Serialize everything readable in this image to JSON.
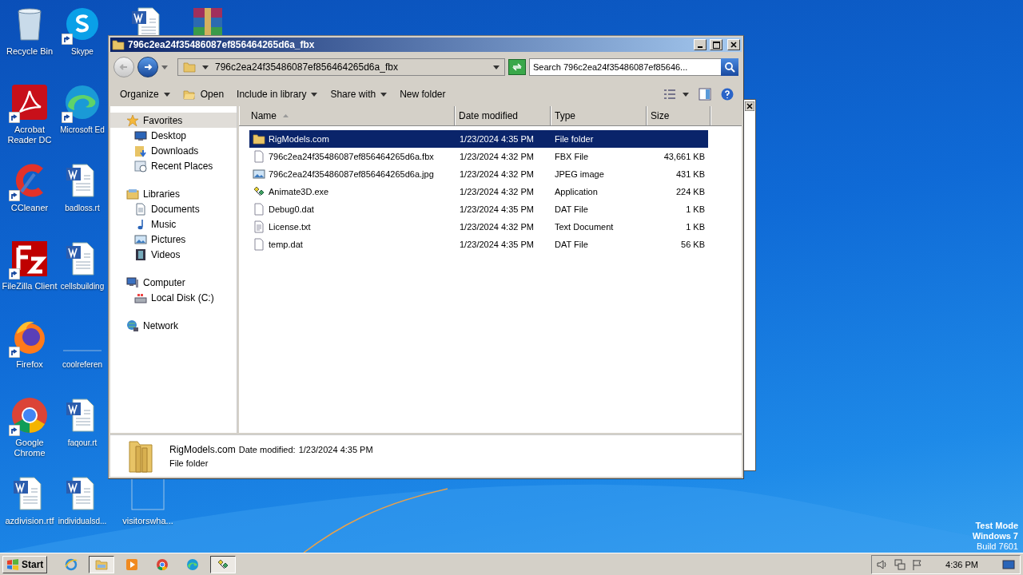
{
  "desktop": {
    "icons": [
      {
        "label": "Recycle Bin",
        "kind": "recycle",
        "shortcut": false
      },
      {
        "label": "Acrobat Reader DC",
        "kind": "acrobat",
        "shortcut": true
      },
      {
        "label": "CCleaner",
        "kind": "ccleaner",
        "shortcut": true
      },
      {
        "label": "FileZilla Client",
        "kind": "filezilla",
        "shortcut": true
      },
      {
        "label": "Firefox",
        "kind": "firefox",
        "shortcut": true
      },
      {
        "label": "Google Chrome",
        "kind": "chrome",
        "shortcut": true
      },
      {
        "label": "azdivision.rtf",
        "kind": "word",
        "shortcut": false
      },
      {
        "label": "Skype",
        "kind": "skype",
        "shortcut": true
      },
      {
        "label": "Microsoft Ed",
        "kind": "edge",
        "shortcut": true
      },
      {
        "label": "badloss.rt",
        "kind": "word",
        "shortcut": false
      },
      {
        "label": "cellsbuilding",
        "kind": "word",
        "shortcut": false
      },
      {
        "label": "coolreferen",
        "kind": "blank",
        "shortcut": false
      },
      {
        "label": "faqour.rt",
        "kind": "word",
        "shortcut": false
      },
      {
        "label": "individualsd...",
        "kind": "word",
        "shortcut": false
      },
      {
        "kind": "word",
        "shortcut": false
      },
      {
        "label": "visitorswha...",
        "kind": "outline",
        "shortcut": false
      },
      {
        "kind": "winrar",
        "shortcut": false
      }
    ]
  },
  "explorer": {
    "title": "796c2ea24f35486087ef856464265d6a_fbx",
    "back_disabled": true,
    "address": "796c2ea24f35486087ef856464265d6a_fbx",
    "search": {
      "placeholder": "Search 796c2ea24f35486087ef85646..."
    },
    "toolbar": [
      {
        "label": "Organize",
        "kind": "menu"
      },
      {
        "label": "Open",
        "kind": "open"
      },
      {
        "label": "Include in library",
        "kind": "menu"
      },
      {
        "label": "Share with",
        "kind": "menu"
      },
      {
        "label": "New folder",
        "kind": "plain"
      }
    ],
    "nav": [
      {
        "label": "Favorites",
        "kind": "star",
        "selected": true,
        "children": [
          {
            "label": "Desktop",
            "kind": "desktop",
            "selected": false
          },
          {
            "label": "Downloads",
            "kind": "downloads",
            "selected": false
          },
          {
            "label": "Recent Places",
            "kind": "recent",
            "selected": false
          }
        ]
      },
      {
        "label": "Libraries",
        "kind": "libraries",
        "selected": false,
        "children": [
          {
            "label": "Documents",
            "kind": "documents",
            "selected": false
          },
          {
            "label": "Music",
            "kind": "music",
            "selected": false
          },
          {
            "label": "Pictures",
            "kind": "pictures",
            "selected": false
          },
          {
            "label": "Videos",
            "kind": "videos",
            "selected": false
          }
        ]
      },
      {
        "label": "Computer",
        "kind": "computer",
        "selected": false,
        "children": [
          {
            "label": "Local Disk (C:)",
            "kind": "disk",
            "selected": false
          }
        ]
      },
      {
        "label": "Network",
        "kind": "network",
        "selected": false
      }
    ],
    "columns": [
      {
        "label": "Name",
        "sorted": true
      },
      {
        "label": "Date modified",
        "sorted": false
      },
      {
        "label": "Type",
        "sorted": false
      },
      {
        "label": "Size",
        "sorted": false
      }
    ],
    "rows": [
      {
        "name": "RigModels.com",
        "kind": "folder",
        "date": "1/23/2024 4:35 PM",
        "type": "File folder",
        "size": "",
        "selected": true
      },
      {
        "name": "796c2ea24f35486087ef856464265d6a.fbx",
        "kind": "file",
        "date": "1/23/2024 4:32 PM",
        "type": "FBX File",
        "size": "43,661 KB",
        "selected": false
      },
      {
        "name": "796c2ea24f35486087ef856464265d6a.jpg",
        "kind": "image",
        "date": "1/23/2024 4:32 PM",
        "type": "JPEG image",
        "size": "431 KB",
        "selected": false
      },
      {
        "name": "Animate3D.exe",
        "kind": "app",
        "date": "1/23/2024 4:32 PM",
        "type": "Application",
        "size": "224 KB",
        "selected": false
      },
      {
        "name": "Debug0.dat",
        "kind": "file",
        "date": "1/23/2024 4:35 PM",
        "type": "DAT File",
        "size": "1 KB",
        "selected": false
      },
      {
        "name": "License.txt",
        "kind": "text",
        "date": "1/23/2024 4:32 PM",
        "type": "Text Document",
        "size": "1 KB",
        "selected": false
      },
      {
        "name": "temp.dat",
        "kind": "file",
        "date": "1/23/2024 4:35 PM",
        "type": "DAT File",
        "size": "56 KB",
        "selected": false
      }
    ],
    "details": {
      "name": "RigModels.com",
      "date_label": "Date modified:",
      "date": "1/23/2024 4:35 PM",
      "type": "File folder"
    }
  },
  "taskbar": {
    "start": "Start",
    "apps": [
      {
        "kind": "ie",
        "selected": false
      },
      {
        "kind": "explorer",
        "selected": true
      },
      {
        "kind": "media",
        "selected": false
      },
      {
        "kind": "chrome",
        "selected": false
      },
      {
        "kind": "edge",
        "selected": false
      },
      {
        "kind": "animate",
        "selected": true
      }
    ],
    "clock": "4:36 PM"
  },
  "os_notice": [
    "Test Mode",
    "Windows 7",
    "Build 7601"
  ]
}
